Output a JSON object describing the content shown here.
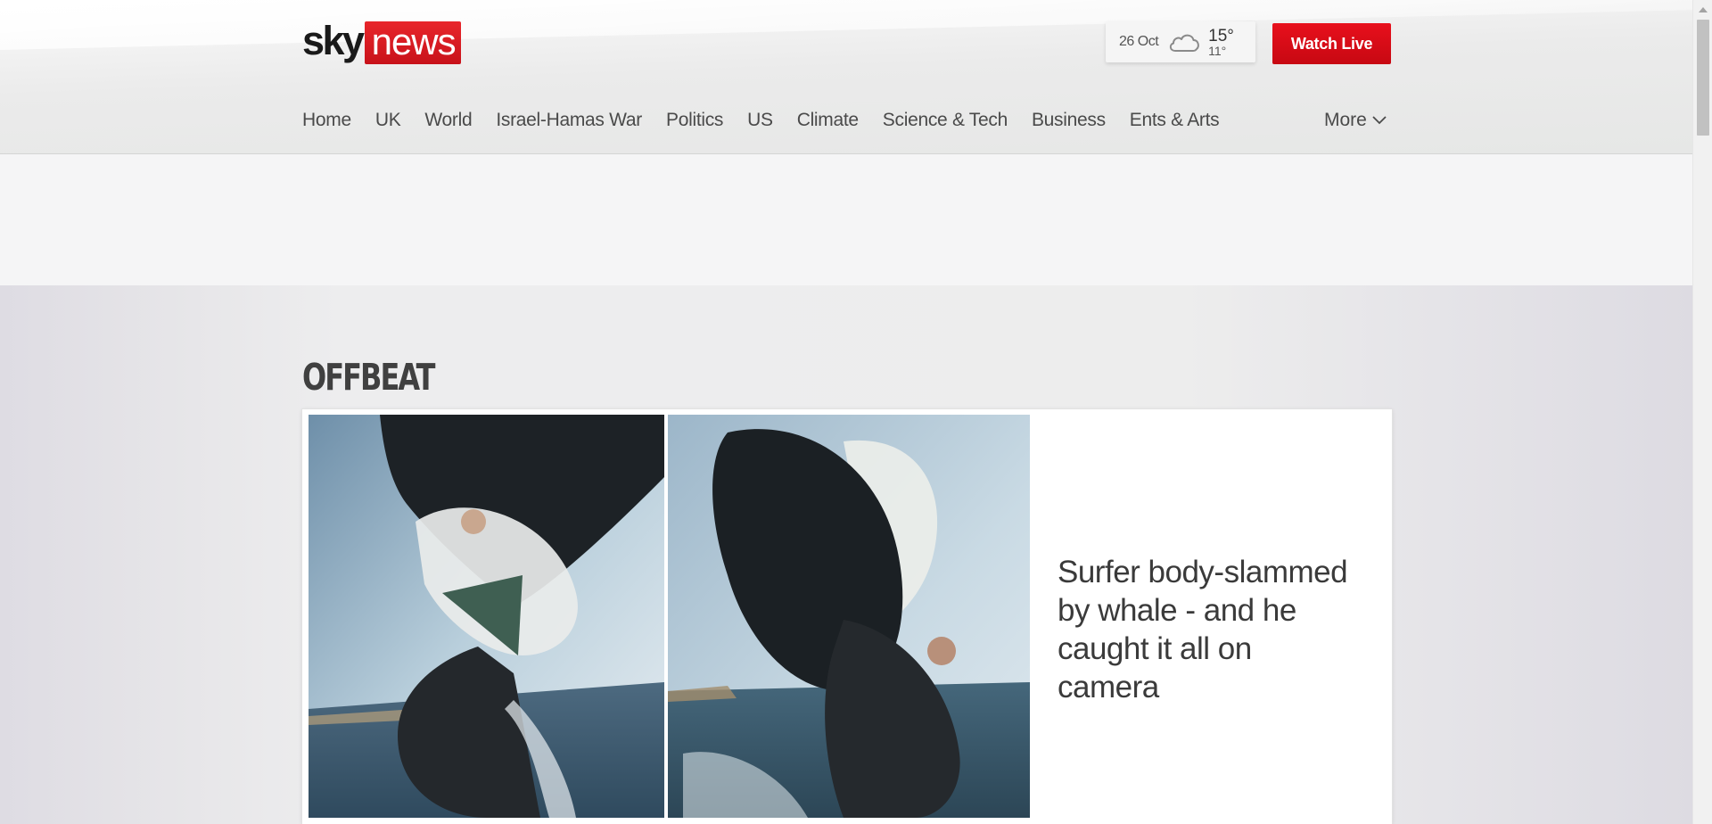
{
  "header": {
    "logo": {
      "sky": "sky",
      "news": "news"
    },
    "weather": {
      "date": "26 Oct",
      "icon": "cloud-icon",
      "high": "15°",
      "low": "11°"
    },
    "watch_live_label": "Watch Live"
  },
  "nav": {
    "items": [
      {
        "label": "Home"
      },
      {
        "label": "UK"
      },
      {
        "label": "World"
      },
      {
        "label": "Israel-Hamas War"
      },
      {
        "label": "Politics"
      },
      {
        "label": "US"
      },
      {
        "label": "Climate"
      },
      {
        "label": "Science & Tech"
      },
      {
        "label": "Business"
      },
      {
        "label": "Ents & Arts"
      }
    ],
    "more_label": "More"
  },
  "section": {
    "title": "OFFBEAT",
    "card": {
      "headline": "Surfer body-slammed by whale - and he caught it all on camera",
      "image_icon": "whale-surfer-photo"
    }
  },
  "colors": {
    "brand_red": "#d3111b",
    "text": "#4a4a4a",
    "page_bg": "#ededed"
  }
}
